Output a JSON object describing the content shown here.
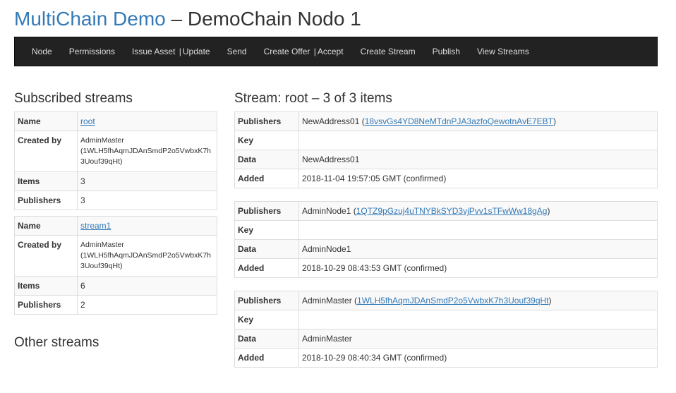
{
  "header": {
    "brand": "MultiChain Demo",
    "dash": " – ",
    "node": "DemoChain Nodo 1"
  },
  "nav": [
    {
      "label": "Node"
    },
    {
      "label": "Permissions"
    },
    {
      "label": "Issue Asset",
      "label2": "Update"
    },
    {
      "label": "Send"
    },
    {
      "label": "Create Offer",
      "label2": "Accept"
    },
    {
      "label": "Create Stream"
    },
    {
      "label": "Publish"
    },
    {
      "label": "View Streams"
    }
  ],
  "subscribed": {
    "title": "Subscribed streams",
    "labels": {
      "name": "Name",
      "created_by": "Created by",
      "items": "Items",
      "publishers": "Publishers"
    },
    "streams": [
      {
        "name": "root",
        "created_by": "AdminMaster",
        "created_addr": "(1WLH5fhAqmJDAnSmdP2o5VwbxK7h3Uouf39qHt)",
        "items": "3",
        "publishers": "3"
      },
      {
        "name": "stream1",
        "created_by": "AdminMaster",
        "created_addr": "(1WLH5fhAqmJDAnSmdP2o5VwbxK7h3Uouf39qHt)",
        "items": "6",
        "publishers": "2"
      }
    ]
  },
  "other": {
    "title": "Other streams"
  },
  "stream_view": {
    "title": "Stream: root – 3 of 3 items",
    "labels": {
      "publishers": "Publishers",
      "key": "Key",
      "data": "Data",
      "added": "Added"
    },
    "items": [
      {
        "publisher_name": "NewAddress01",
        "publisher_addr": "18vsvGs4YD8NeMTdnPJA3azfoQewotnAvE7EBT",
        "key": "",
        "data": "NewAddress01",
        "added": "2018-11-04 19:57:05 GMT (confirmed)"
      },
      {
        "publisher_name": "AdminNode1",
        "publisher_addr": "1QTZ9pGzuj4uTNYBkSYD3vjPvv1sTFwWw18gAg",
        "key": "",
        "data": "AdminNode1",
        "added": "2018-10-29 08:43:53 GMT (confirmed)"
      },
      {
        "publisher_name": "AdminMaster",
        "publisher_addr": "1WLH5fhAqmJDAnSmdP2o5VwbxK7h3Uouf39qHt",
        "key": "",
        "data": "AdminMaster",
        "added": "2018-10-29 08:40:34 GMT (confirmed)"
      }
    ]
  }
}
